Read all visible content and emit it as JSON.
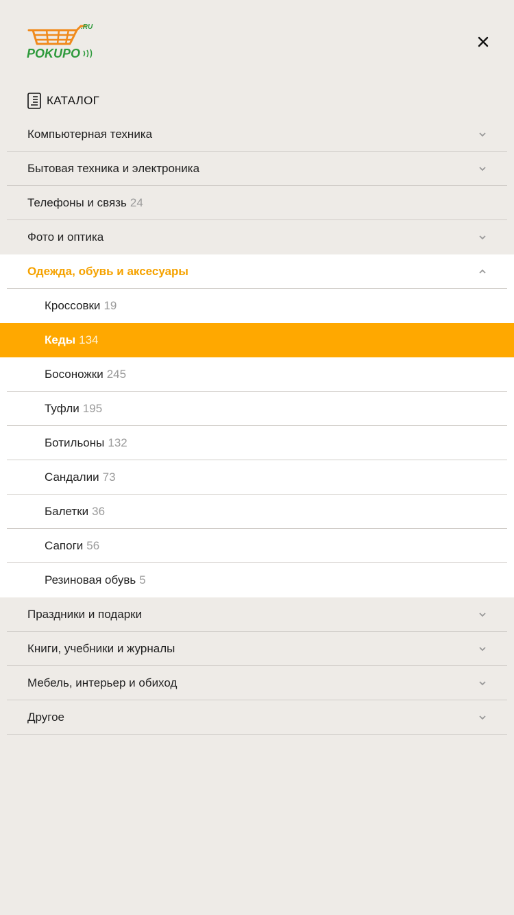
{
  "logo": {
    "text": "POKUPO",
    "suffix": ".RU"
  },
  "catalog": {
    "title": "КАТАЛОГ"
  },
  "menu": {
    "categories_top": [
      {
        "label": "Компьютерная техника",
        "count": "",
        "expandable": true
      },
      {
        "label": "Бытовая техника и электроника",
        "count": "",
        "expandable": true
      },
      {
        "label": "Телефоны и связь",
        "count": "24",
        "expandable": false
      },
      {
        "label": "Фото и оптика",
        "count": "",
        "expandable": true
      }
    ],
    "open_category": {
      "label": "Одежда, обувь и аксесуары"
    },
    "subcategories": [
      {
        "label": "Кроссовки",
        "count": "19"
      },
      {
        "label": "Кеды",
        "count": "134",
        "active": true
      },
      {
        "label": "Босоножки",
        "count": "245"
      },
      {
        "label": "Туфли",
        "count": "195"
      },
      {
        "label": "Ботильоны",
        "count": "132"
      },
      {
        "label": "Сандалии",
        "count": "73"
      },
      {
        "label": "Балетки",
        "count": "36"
      },
      {
        "label": "Сапоги",
        "count": "56"
      },
      {
        "label": "Резиновая обувь",
        "count": "5"
      }
    ],
    "categories_bottom": [
      {
        "label": "Праздники и подарки",
        "count": ""
      },
      {
        "label": "Книги, учебники и журналы",
        "count": ""
      },
      {
        "label": "Мебель, интерьер и обиход",
        "count": ""
      },
      {
        "label": "Другое",
        "count": ""
      }
    ]
  },
  "colors": {
    "accent": "#ffa800",
    "accent_text": "#f5a200",
    "logo_green": "#2e9a3c",
    "logo_orange": "#f08a1c",
    "background": "#eeebe7"
  },
  "icons": {
    "close": "close-icon",
    "catalog": "document-icon",
    "expand": "chevron-down-icon",
    "collapse": "chevron-up-icon"
  }
}
